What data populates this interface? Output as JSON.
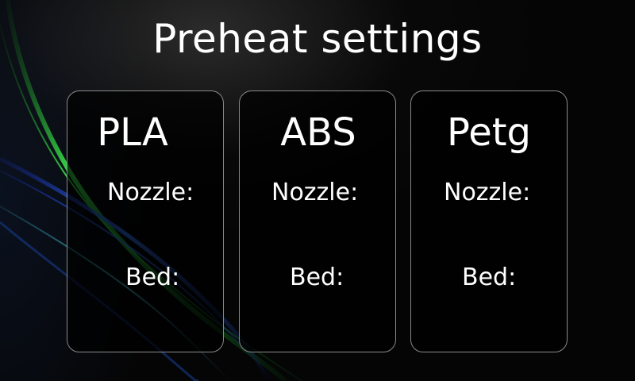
{
  "screen": {
    "title": "Preheat settings"
  },
  "presets": [
    {
      "name": "PLA",
      "nozzle_label": "Nozzle:",
      "bed_label": "Bed:"
    },
    {
      "name": "ABS",
      "nozzle_label": "Nozzle:",
      "bed_label": "Bed:"
    },
    {
      "name": "Petg",
      "nozzle_label": "Nozzle:",
      "bed_label": "Bed:"
    }
  ],
  "colors": {
    "background": "#050505",
    "text": "#ffffff",
    "card_border": "#8a8a8a",
    "swoosh_green": "#34d84a",
    "swoosh_blue": "#2a6cff"
  }
}
